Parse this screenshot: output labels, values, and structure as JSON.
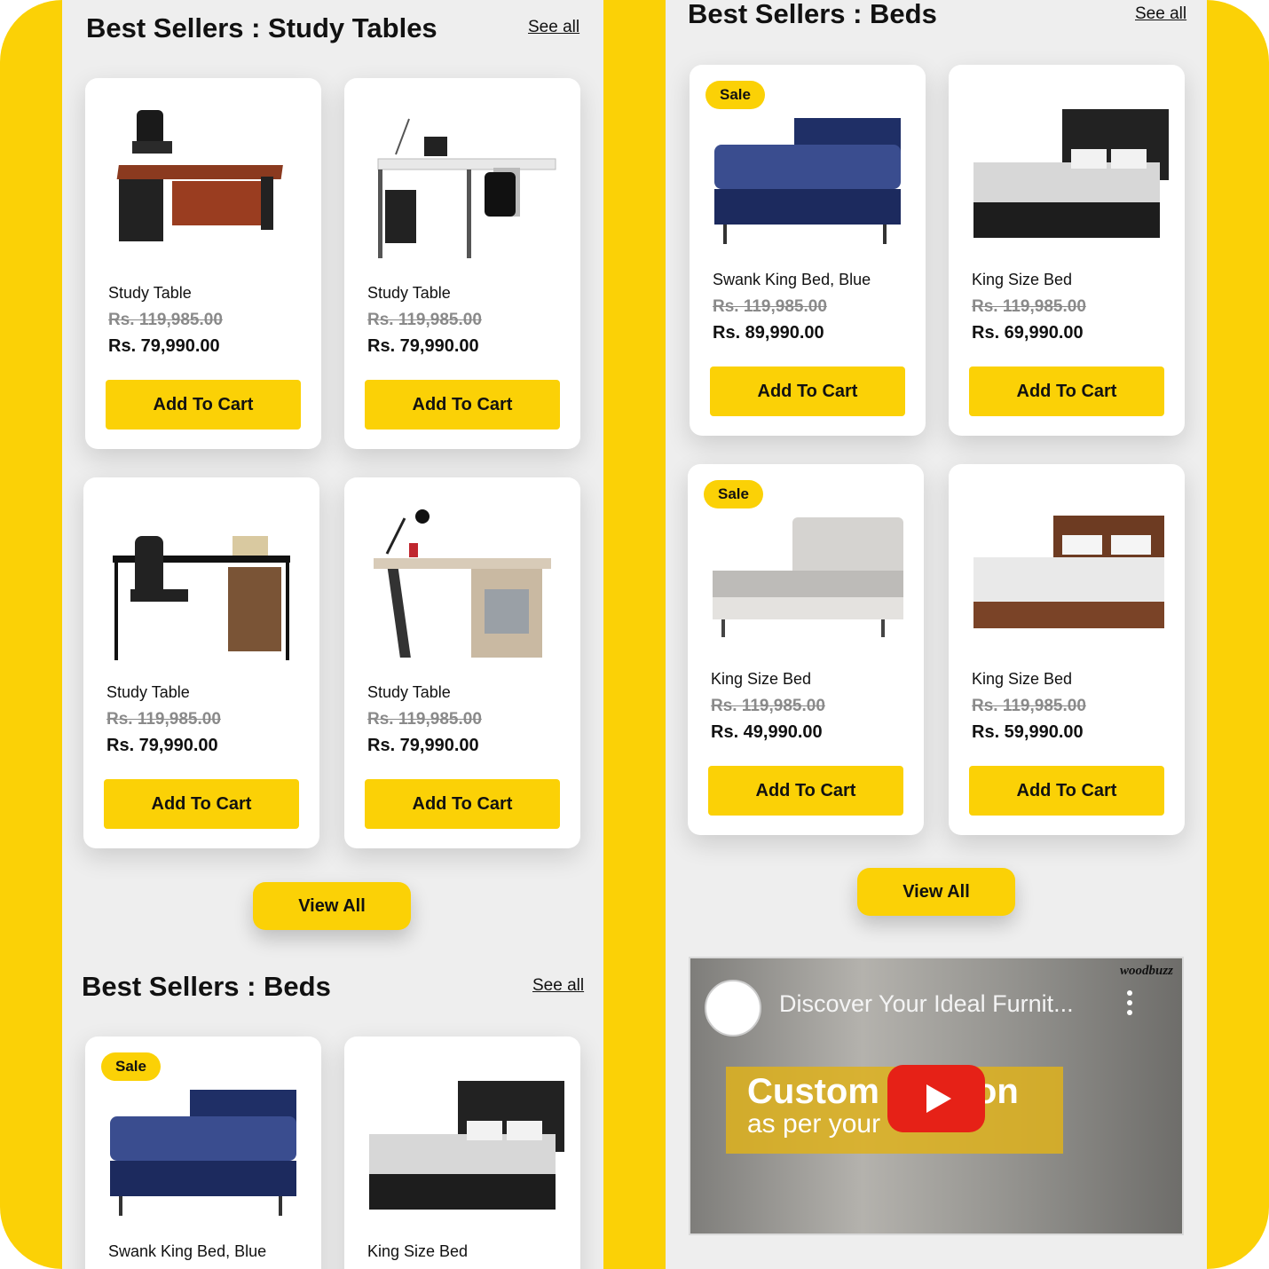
{
  "colors": {
    "accent": "#fbd106",
    "card_bg": "#ffffff",
    "page_bg": "#eeeeee",
    "strike": "#8a8a8a"
  },
  "left": {
    "section1": {
      "title": "Best Sellers : Study Tables",
      "see_all": "See all",
      "products": [
        {
          "name": "Study Table",
          "old_price": "Rs. 119,985.00",
          "price": "Rs. 79,990.00",
          "button": "Add To Cart"
        },
        {
          "name": "Study Table",
          "old_price": "Rs. 119,985.00",
          "price": "Rs. 79,990.00",
          "button": "Add To Cart"
        },
        {
          "name": "Study Table",
          "old_price": "Rs. 119,985.00",
          "price": "Rs. 79,990.00",
          "button": "Add To Cart"
        },
        {
          "name": "Study Table",
          "old_price": "Rs. 119,985.00",
          "price": "Rs. 79,990.00",
          "button": "Add To Cart"
        }
      ],
      "view_all": "View All"
    },
    "section2": {
      "title": "Best Sellers : Beds",
      "see_all": "See all",
      "products": [
        {
          "badge": "Sale",
          "name": "Swank King Bed, Blue"
        },
        {
          "name": "King Size Bed"
        }
      ]
    }
  },
  "right": {
    "section": {
      "title": "Best Sellers : Beds",
      "see_all": "See all",
      "products": [
        {
          "badge": "Sale",
          "name": "Swank King Bed, Blue",
          "old_price": "Rs. 119,985.00",
          "price": "Rs. 89,990.00",
          "button": "Add To Cart"
        },
        {
          "name": "King Size Bed",
          "old_price": "Rs. 119,985.00",
          "price": "Rs. 69,990.00",
          "button": "Add To Cart"
        },
        {
          "badge": "Sale",
          "name": "King Size Bed",
          "old_price": "Rs. 119,985.00",
          "price": "Rs. 49,990.00",
          "button": "Add To Cart"
        },
        {
          "name": "King Size Bed",
          "old_price": "Rs. 119,985.00",
          "price": "Rs. 59,990.00",
          "button": "Add To Cart"
        }
      ],
      "view_all": "View All"
    },
    "video": {
      "title": "Discover Your Ideal Furnit...",
      "overlay_big": "Custom",
      "overlay_big_end": "on",
      "overlay_small": "as per your",
      "brand": "woodbuzz",
      "icons": [
        "channel-logo-icon",
        "youtube-play-icon",
        "more-vert-icon"
      ]
    }
  }
}
